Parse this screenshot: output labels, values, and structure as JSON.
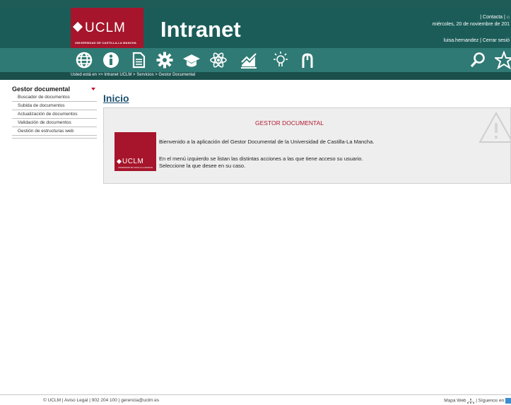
{
  "header": {
    "logo_text": "UCLM",
    "logo_subtitle": "UNIVERSIDAD DE CASTILLA-LA MANCHA",
    "title": "Intranet",
    "contact_link": "| Contacta |",
    "date": "miércoles, 20 de noviembre de 201",
    "username": "luisa.hernandez",
    "logout": "| Cerrar sesió"
  },
  "nav_icons": [
    "globe-icon",
    "info-icon",
    "document-icon",
    "gear-icon",
    "graduation-cap-icon",
    "atom-icon",
    "chart-icon",
    "lightbulb-icon",
    "mouse-icon"
  ],
  "right_icons": [
    "search-icon",
    "star-icon"
  ],
  "breadcrumb": {
    "prefix": "Usted está en >>",
    "path": "Intranet UCLM > Servicios > Gestor Documental"
  },
  "sidebar": {
    "title": "Gestor documental",
    "items": [
      {
        "label": "Buscador de documentos"
      },
      {
        "label": "Subida de documentos"
      },
      {
        "label": "Actualización de documentos"
      },
      {
        "label": "Validación de documentos"
      },
      {
        "label": "Gestión de estructuras web"
      }
    ]
  },
  "main": {
    "page_title": "Inicio",
    "panel_title": "GESTOR DOCUMENTAL",
    "panel_logo_text": "UCLM",
    "panel_logo_subtitle": "UNIVERSIDAD DE CASTILLA-LA MANCHA",
    "welcome": "Bienvenido a la aplicación del Gestor Documental de la Universidad de Castilla-La Mancha.",
    "line1": "En el menú izquierdo se listan las distintas acciones a las que tiene acceso su usuario.",
    "line2": "Seleccione la que desee en su caso."
  },
  "footer": {
    "left": "© UCLM | Aviso Legal | 902 204 100 | gerencia@uclm.es",
    "sitemap": "Mapa Web",
    "follow": "| Síguenos en"
  },
  "colors": {
    "header_bg": "#1f5c58",
    "icon_bar": "#2f7a74",
    "brand_red": "#a6152b",
    "title_blue": "#1a4f6e"
  }
}
